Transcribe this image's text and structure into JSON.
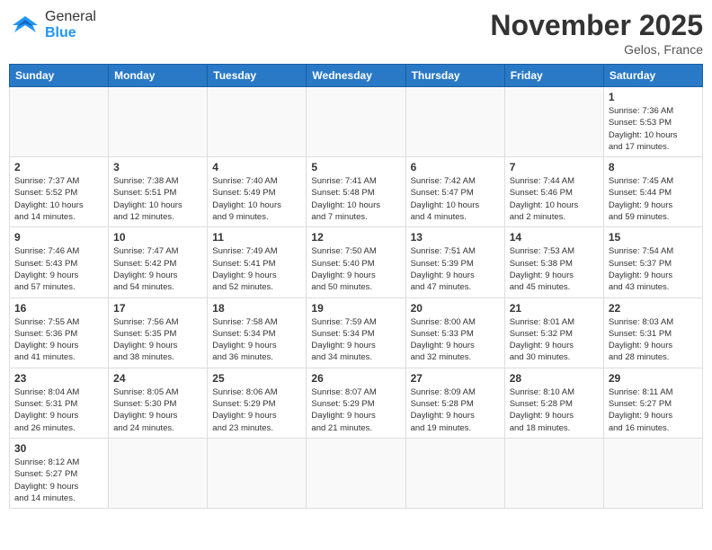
{
  "header": {
    "logo_general": "General",
    "logo_blue": "Blue",
    "month_title": "November 2025",
    "location": "Gelos, France"
  },
  "weekdays": [
    "Sunday",
    "Monday",
    "Tuesday",
    "Wednesday",
    "Thursday",
    "Friday",
    "Saturday"
  ],
  "weeks": [
    [
      {
        "day": "",
        "info": ""
      },
      {
        "day": "",
        "info": ""
      },
      {
        "day": "",
        "info": ""
      },
      {
        "day": "",
        "info": ""
      },
      {
        "day": "",
        "info": ""
      },
      {
        "day": "",
        "info": ""
      },
      {
        "day": "1",
        "info": "Sunrise: 7:36 AM\nSunset: 5:53 PM\nDaylight: 10 hours\nand 17 minutes."
      }
    ],
    [
      {
        "day": "2",
        "info": "Sunrise: 7:37 AM\nSunset: 5:52 PM\nDaylight: 10 hours\nand 14 minutes."
      },
      {
        "day": "3",
        "info": "Sunrise: 7:38 AM\nSunset: 5:51 PM\nDaylight: 10 hours\nand 12 minutes."
      },
      {
        "day": "4",
        "info": "Sunrise: 7:40 AM\nSunset: 5:49 PM\nDaylight: 10 hours\nand 9 minutes."
      },
      {
        "day": "5",
        "info": "Sunrise: 7:41 AM\nSunset: 5:48 PM\nDaylight: 10 hours\nand 7 minutes."
      },
      {
        "day": "6",
        "info": "Sunrise: 7:42 AM\nSunset: 5:47 PM\nDaylight: 10 hours\nand 4 minutes."
      },
      {
        "day": "7",
        "info": "Sunrise: 7:44 AM\nSunset: 5:46 PM\nDaylight: 10 hours\nand 2 minutes."
      },
      {
        "day": "8",
        "info": "Sunrise: 7:45 AM\nSunset: 5:44 PM\nDaylight: 9 hours\nand 59 minutes."
      }
    ],
    [
      {
        "day": "9",
        "info": "Sunrise: 7:46 AM\nSunset: 5:43 PM\nDaylight: 9 hours\nand 57 minutes."
      },
      {
        "day": "10",
        "info": "Sunrise: 7:47 AM\nSunset: 5:42 PM\nDaylight: 9 hours\nand 54 minutes."
      },
      {
        "day": "11",
        "info": "Sunrise: 7:49 AM\nSunset: 5:41 PM\nDaylight: 9 hours\nand 52 minutes."
      },
      {
        "day": "12",
        "info": "Sunrise: 7:50 AM\nSunset: 5:40 PM\nDaylight: 9 hours\nand 50 minutes."
      },
      {
        "day": "13",
        "info": "Sunrise: 7:51 AM\nSunset: 5:39 PM\nDaylight: 9 hours\nand 47 minutes."
      },
      {
        "day": "14",
        "info": "Sunrise: 7:53 AM\nSunset: 5:38 PM\nDaylight: 9 hours\nand 45 minutes."
      },
      {
        "day": "15",
        "info": "Sunrise: 7:54 AM\nSunset: 5:37 PM\nDaylight: 9 hours\nand 43 minutes."
      }
    ],
    [
      {
        "day": "16",
        "info": "Sunrise: 7:55 AM\nSunset: 5:36 PM\nDaylight: 9 hours\nand 41 minutes."
      },
      {
        "day": "17",
        "info": "Sunrise: 7:56 AM\nSunset: 5:35 PM\nDaylight: 9 hours\nand 38 minutes."
      },
      {
        "day": "18",
        "info": "Sunrise: 7:58 AM\nSunset: 5:34 PM\nDaylight: 9 hours\nand 36 minutes."
      },
      {
        "day": "19",
        "info": "Sunrise: 7:59 AM\nSunset: 5:34 PM\nDaylight: 9 hours\nand 34 minutes."
      },
      {
        "day": "20",
        "info": "Sunrise: 8:00 AM\nSunset: 5:33 PM\nDaylight: 9 hours\nand 32 minutes."
      },
      {
        "day": "21",
        "info": "Sunrise: 8:01 AM\nSunset: 5:32 PM\nDaylight: 9 hours\nand 30 minutes."
      },
      {
        "day": "22",
        "info": "Sunrise: 8:03 AM\nSunset: 5:31 PM\nDaylight: 9 hours\nand 28 minutes."
      }
    ],
    [
      {
        "day": "23",
        "info": "Sunrise: 8:04 AM\nSunset: 5:31 PM\nDaylight: 9 hours\nand 26 minutes."
      },
      {
        "day": "24",
        "info": "Sunrise: 8:05 AM\nSunset: 5:30 PM\nDaylight: 9 hours\nand 24 minutes."
      },
      {
        "day": "25",
        "info": "Sunrise: 8:06 AM\nSunset: 5:29 PM\nDaylight: 9 hours\nand 23 minutes."
      },
      {
        "day": "26",
        "info": "Sunrise: 8:07 AM\nSunset: 5:29 PM\nDaylight: 9 hours\nand 21 minutes."
      },
      {
        "day": "27",
        "info": "Sunrise: 8:09 AM\nSunset: 5:28 PM\nDaylight: 9 hours\nand 19 minutes."
      },
      {
        "day": "28",
        "info": "Sunrise: 8:10 AM\nSunset: 5:28 PM\nDaylight: 9 hours\nand 18 minutes."
      },
      {
        "day": "29",
        "info": "Sunrise: 8:11 AM\nSunset: 5:27 PM\nDaylight: 9 hours\nand 16 minutes."
      }
    ],
    [
      {
        "day": "30",
        "info": "Sunrise: 8:12 AM\nSunset: 5:27 PM\nDaylight: 9 hours\nand 14 minutes."
      },
      {
        "day": "",
        "info": ""
      },
      {
        "day": "",
        "info": ""
      },
      {
        "day": "",
        "info": ""
      },
      {
        "day": "",
        "info": ""
      },
      {
        "day": "",
        "info": ""
      },
      {
        "day": "",
        "info": ""
      }
    ]
  ]
}
